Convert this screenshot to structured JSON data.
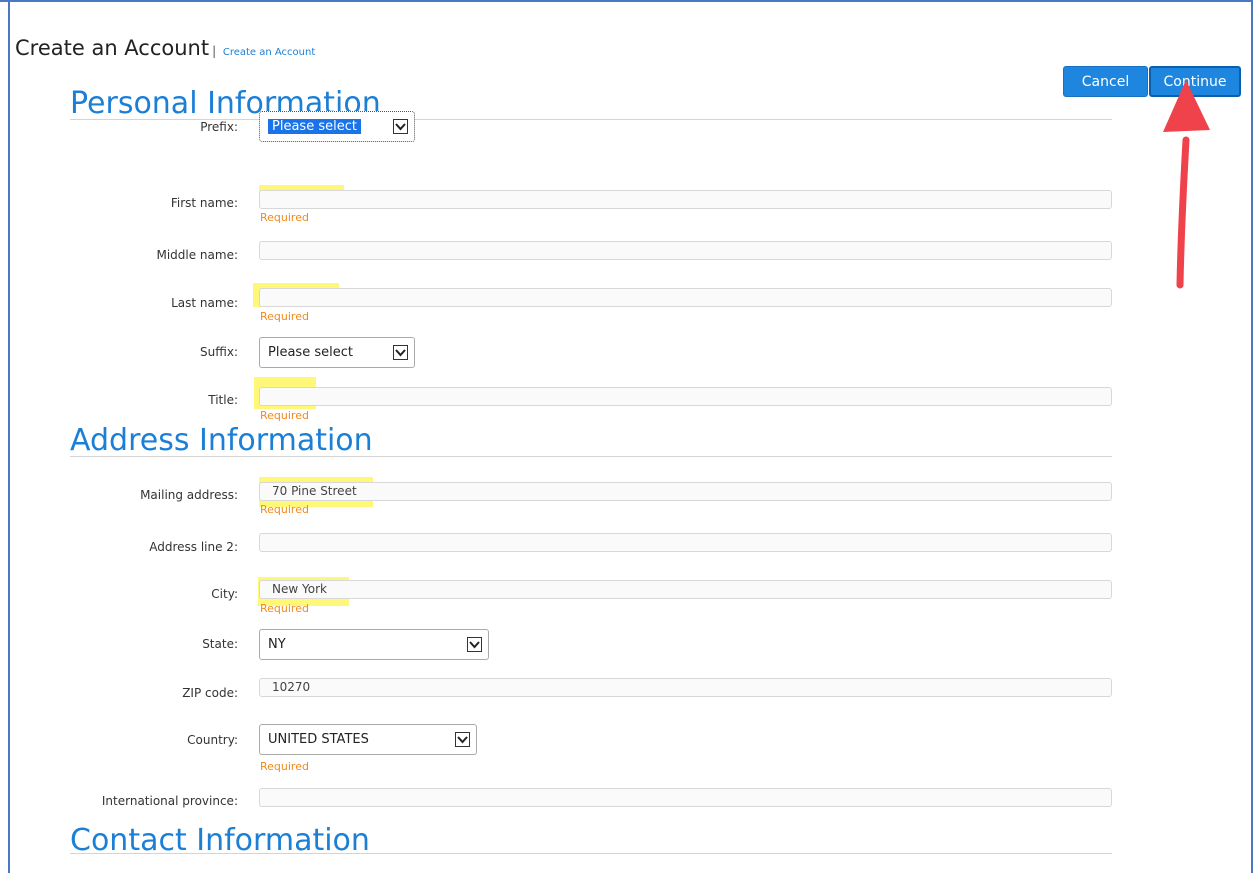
{
  "page": {
    "title": "Create an Account",
    "separator": "|",
    "breadcrumb": "Create an Account"
  },
  "actions": {
    "cancel_label": "Cancel",
    "continue_label": "Continue"
  },
  "sections": {
    "personal": "Personal Information",
    "address": "Address Information",
    "contact": "Contact Information"
  },
  "fields": {
    "prefix": {
      "label": "Prefix:",
      "value": "Please select"
    },
    "first_name": {
      "label": "First name:",
      "value": "",
      "error": "Required"
    },
    "middle_name": {
      "label": "Middle name:",
      "value": ""
    },
    "last_name": {
      "label": "Last name:",
      "value": "",
      "error": "Required"
    },
    "suffix": {
      "label": "Suffix:",
      "value": "Please select"
    },
    "title": {
      "label": "Title:",
      "value": "",
      "error": "Required"
    },
    "mailing_address": {
      "label": "Mailing address:",
      "value": "70 Pine Street",
      "error": "Required"
    },
    "address_line2": {
      "label": "Address line 2:",
      "value": ""
    },
    "city": {
      "label": "City:",
      "value": "New York",
      "error": "Required"
    },
    "state": {
      "label": "State:",
      "value": "NY"
    },
    "zip": {
      "label": "ZIP code:",
      "value": "10270"
    },
    "country": {
      "label": "Country:",
      "value": "UNITED STATES",
      "error": "Required"
    },
    "intl_province": {
      "label": "International province:",
      "value": ""
    }
  },
  "colors": {
    "accent": "#1c7fd6",
    "button": "#1f86e0",
    "error": "#f08a1c",
    "highlight": "#fff44a",
    "annotation_arrow": "#f0424a"
  },
  "icons": {
    "dropdown": "chevron-down-icon",
    "annotation": "red-arrow-icon"
  }
}
